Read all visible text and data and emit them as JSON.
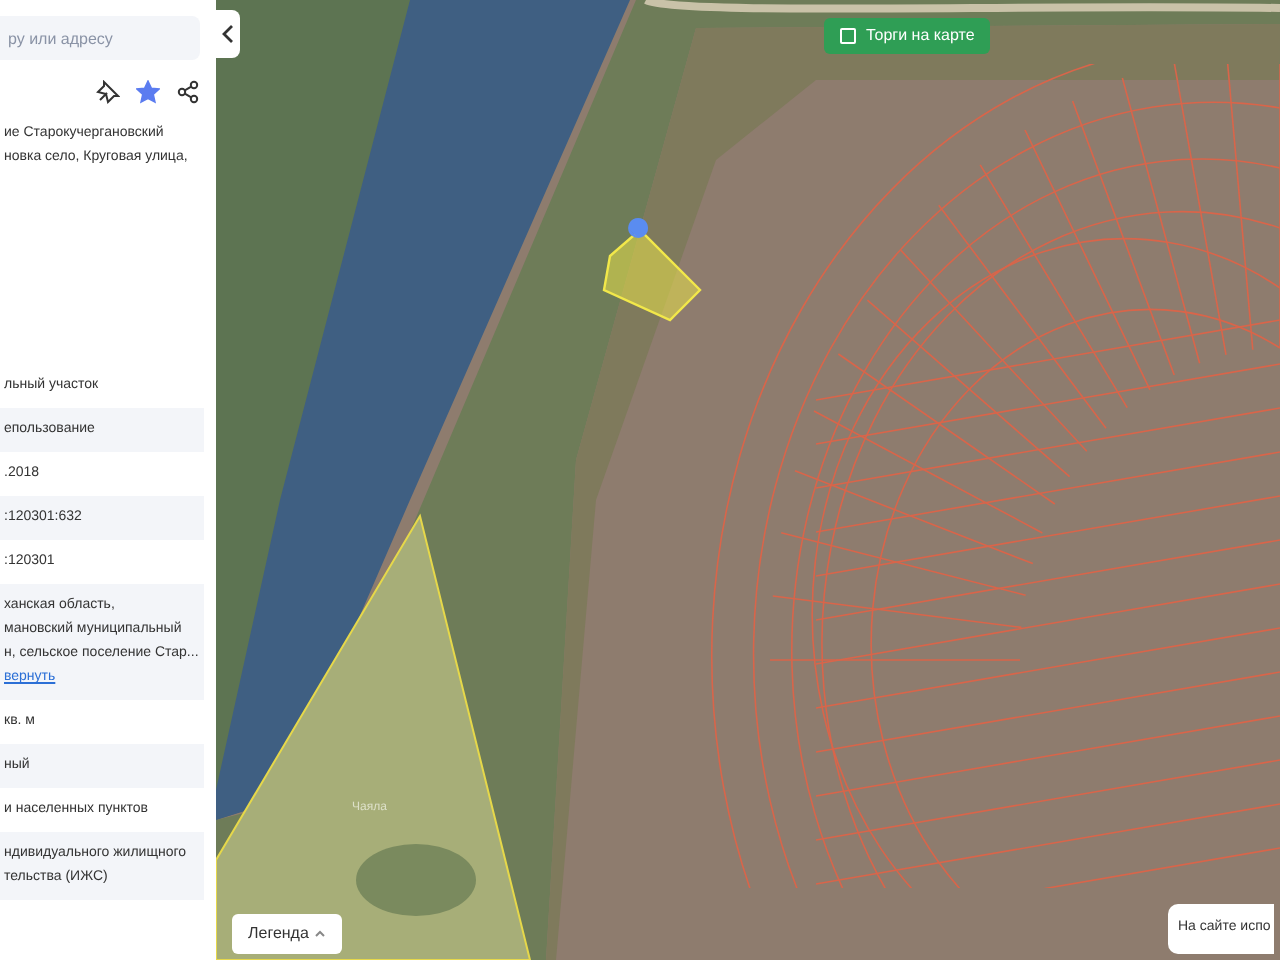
{
  "search": {
    "placeholder": "ру или адресу"
  },
  "actions": {
    "pinned": false,
    "favorite": true
  },
  "address": "ие Старокучергановский новка село, Круговая улица,",
  "details": [
    {
      "lines": [
        "льный участок"
      ]
    },
    {
      "lines": [
        "епользование"
      ]
    },
    {
      "lines": [
        ".2018"
      ]
    },
    {
      "lines": [
        ":120301:632"
      ]
    },
    {
      "lines": [
        ":120301"
      ]
    },
    {
      "lines": [
        "ханская область,",
        "мановский муниципальный",
        "н, сельское поселение Стар..."
      ],
      "link": "вернуть"
    },
    {
      "lines": [
        "кв. м"
      ]
    },
    {
      "lines": [
        "ный"
      ]
    },
    {
      "lines": [
        "и населенных пунктов"
      ]
    },
    {
      "lines": [
        "ндивидуального жилищного",
        "тельства (ИЖС)"
      ]
    }
  ],
  "map": {
    "auctions_toggle": {
      "label": "Торги на карте",
      "checked": false
    },
    "legend_button": "Легенда",
    "site_button": "На сайте испо",
    "highlight_label": "Чаяла"
  }
}
